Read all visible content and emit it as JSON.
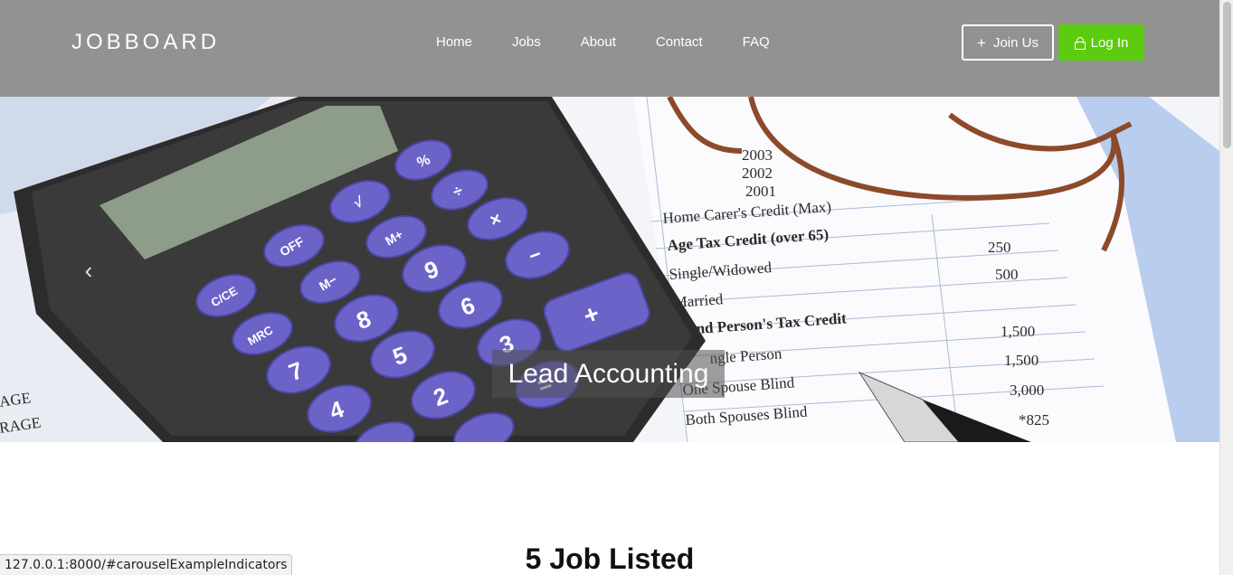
{
  "navbar": {
    "brand": "JOBBOARD",
    "links": [
      "Home",
      "Jobs",
      "About",
      "Contact",
      "FAQ"
    ],
    "join_label": "Join Us",
    "join_icon": "plus-icon",
    "login_label": "Log In",
    "login_icon": "lock-icon",
    "background": "#929292",
    "login_color": "#5ccc0f"
  },
  "carousel": {
    "caption": "Lead Accounting",
    "prev_icon": "chevron-left-icon",
    "next_icon": "chevron-right-icon"
  },
  "section": {
    "title": "5 Job Listed"
  },
  "status_bar": {
    "url": "127.0.0.1:8000/#carouselExampleIndicators"
  }
}
